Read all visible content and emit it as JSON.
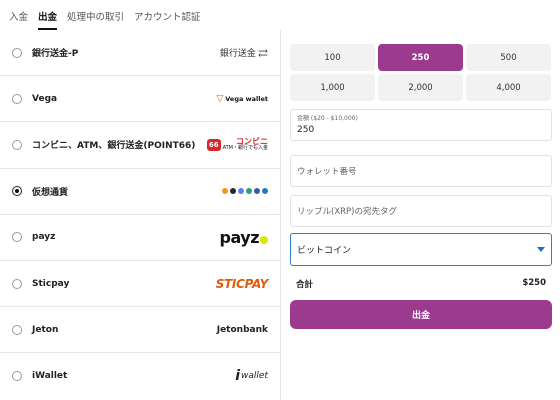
{
  "tabs": [
    {
      "label": "入金"
    },
    {
      "label": "出金"
    },
    {
      "label": "処理中の取引"
    },
    {
      "label": "アカウント認証"
    }
  ],
  "active_tab": 1,
  "methods": [
    {
      "label": "銀行送金-P",
      "logo": "銀行送金",
      "checked": false
    },
    {
      "label": "Vega",
      "logo": "Vega wallet",
      "checked": false
    },
    {
      "label": "コンビニ、ATM、銀行送金(POINT66)",
      "logo_badge": "66",
      "logo_top": "コンビニ",
      "logo_bottom": "ATM・銀行でも入金",
      "checked": false
    },
    {
      "label": "仮想通貨",
      "logo": "crypto-coins-icons",
      "checked": true
    },
    {
      "label": "payz",
      "logo": "payz",
      "checked": false
    },
    {
      "label": "Sticpay",
      "logo": "STICPAY",
      "checked": false
    },
    {
      "label": "Jeton",
      "logo": "Jetonbank",
      "checked": false
    },
    {
      "label": "iWallet",
      "logo": "wallet",
      "checked": false
    }
  ],
  "amounts": [
    "100",
    "250",
    "500",
    "1,000",
    "2,000",
    "4,000"
  ],
  "selected_amount_index": 1,
  "amount_field": {
    "label": "金額 ($20 - $10,000)",
    "value": "250"
  },
  "wallet_field": {
    "placeholder": "ウォレット番号"
  },
  "tag_field": {
    "placeholder": "リップル(XRP)の宛先タグ"
  },
  "currency_select": {
    "value": "ビットコイン"
  },
  "total": {
    "label": "合計",
    "value": "$250"
  },
  "submit_label": "出金",
  "colors": {
    "accent": "#9b3a8e",
    "focus": "#2a7fd0"
  }
}
